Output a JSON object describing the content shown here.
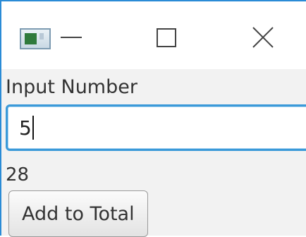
{
  "window": {
    "icon": "java-app-icon",
    "controls": [
      "minimize-icon",
      "maximize-icon",
      "close-icon"
    ]
  },
  "form": {
    "label": "Input Number",
    "input_value": "5",
    "total_value": "28",
    "add_button_label": "Add to Total"
  },
  "colors": {
    "focus_border": "#3b9ad9",
    "window_border": "#2a8bd6",
    "background": "#f2f2f2"
  }
}
